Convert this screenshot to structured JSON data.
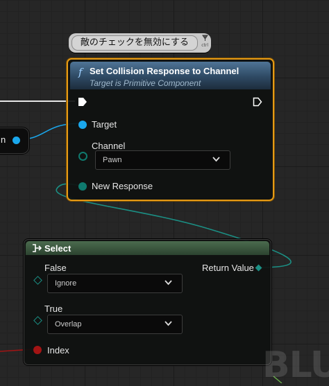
{
  "comment": {
    "text": "敵のチェックを無効にする",
    "controls": "ctrl"
  },
  "partial_node": {
    "label": "n"
  },
  "set_collision": {
    "title": "Set Collision Response to Channel",
    "subtitle": "Target is Primitive Component",
    "target_label": "Target",
    "channel_label": "Channel",
    "channel_value": "Pawn",
    "new_response_label": "New Response"
  },
  "select_node": {
    "title": "Select",
    "false_label": "False",
    "false_value": "Ignore",
    "true_label": "True",
    "true_value": "Overlap",
    "index_label": "Index",
    "return_label": "Return Value"
  },
  "watermark": "BLU",
  "colors": {
    "exec": "#ffffff",
    "object_pin": "#1aa7ec",
    "enum_pin": "#0f7a6e",
    "bool_pin": "#a31414",
    "selected_border": "#e59a16",
    "collision_header": "#4f7496",
    "select_header": "#4b6b4e"
  },
  "icons": [
    "function-icon",
    "exec-pin-icon",
    "object-pin-icon",
    "enum-pin-icon",
    "wildcard-pin-icon",
    "bool-pin-icon",
    "chevron-down-icon",
    "select-icon",
    "pin-icon"
  ]
}
